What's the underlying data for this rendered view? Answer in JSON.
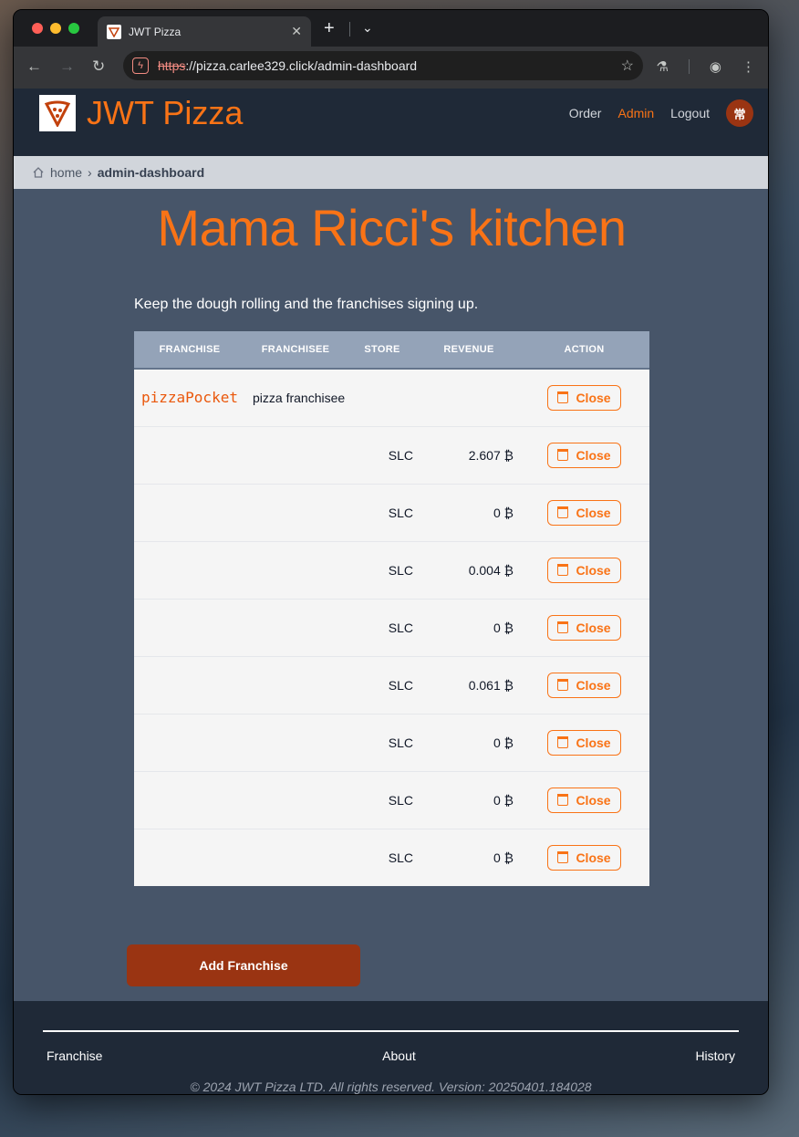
{
  "browser": {
    "tab_title": "JWT Pizza",
    "url_scheme": "https",
    "url_rest": "://pizza.carlee329.click/admin-dashboard"
  },
  "header": {
    "brand": "JWT Pizza",
    "nav": {
      "order": "Order",
      "admin": "Admin",
      "logout": "Logout"
    },
    "avatar": "常"
  },
  "breadcrumb": {
    "home": "home",
    "current": "admin-dashboard"
  },
  "main": {
    "title": "Mama Ricci's kitchen",
    "subtitle": "Keep the dough rolling and the franchises signing up.",
    "table": {
      "headers": [
        "Franchise",
        "Franchisee",
        "Store",
        "Revenue",
        "Action"
      ],
      "franchise": {
        "name": "pizzaPocket",
        "franchisee": "pizza franchisee",
        "action": "Close"
      },
      "stores": [
        {
          "store": "SLC",
          "revenue": "2.607 ₿",
          "action": "Close"
        },
        {
          "store": "SLC",
          "revenue": "0 ₿",
          "action": "Close"
        },
        {
          "store": "SLC",
          "revenue": "0.004 ₿",
          "action": "Close"
        },
        {
          "store": "SLC",
          "revenue": "0 ₿",
          "action": "Close"
        },
        {
          "store": "SLC",
          "revenue": "0.061 ₿",
          "action": "Close"
        },
        {
          "store": "SLC",
          "revenue": "0 ₿",
          "action": "Close"
        },
        {
          "store": "SLC",
          "revenue": "0 ₿",
          "action": "Close"
        },
        {
          "store": "SLC",
          "revenue": "0 ₿",
          "action": "Close"
        }
      ]
    },
    "add_button": "Add Franchise"
  },
  "footer": {
    "links": [
      "Franchise",
      "About",
      "History"
    ],
    "copyright": "© 2024 JWT Pizza LTD. All rights reserved. Version: 20250401.184028"
  },
  "colors": {
    "accent": "#f97316",
    "button": "#9a3412",
    "main_bg": "#475569",
    "header_bg": "#1f2937"
  }
}
